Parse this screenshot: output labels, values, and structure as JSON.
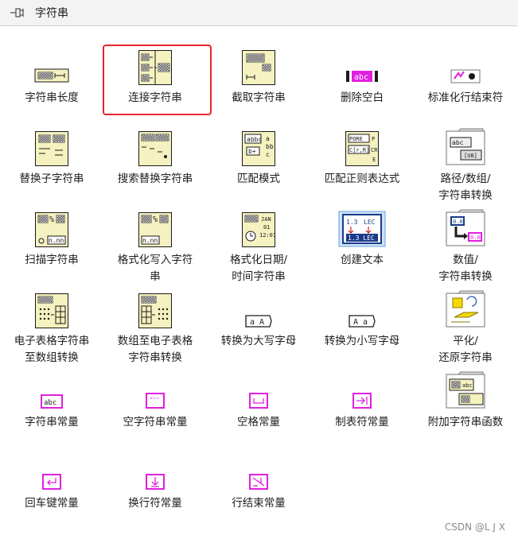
{
  "palette": {
    "title": "字符串",
    "pin_icon": "pin-icon"
  },
  "items": [
    {
      "id": "string-length",
      "lines": [
        "字符串长度"
      ],
      "icon": "string-length-icon"
    },
    {
      "id": "concatenate-strings",
      "lines": [
        "连接字符串"
      ],
      "icon": "concatenate-strings-icon",
      "selected": true
    },
    {
      "id": "string-subset",
      "lines": [
        "截取字符串"
      ],
      "icon": "string-subset-icon"
    },
    {
      "id": "trim-whitespace",
      "lines": [
        "删除空白"
      ],
      "icon": "trim-whitespace-icon"
    },
    {
      "id": "normalize-eol",
      "lines": [
        "标准化行结束符"
      ],
      "icon": "normalize-eol-icon"
    },
    {
      "id": "replace-substring",
      "lines": [
        "替换子字符串"
      ],
      "icon": "replace-substring-icon"
    },
    {
      "id": "search-replace",
      "lines": [
        "搜索替换字符串"
      ],
      "icon": "search-replace-icon"
    },
    {
      "id": "match-pattern",
      "lines": [
        "匹配模式"
      ],
      "icon": "match-pattern-icon"
    },
    {
      "id": "match-regex",
      "lines": [
        "匹配正则表达式"
      ],
      "icon": "match-regex-icon"
    },
    {
      "id": "path-array-string",
      "lines": [
        "路径/数组/",
        "字符串转换"
      ],
      "icon": "folder-icon"
    },
    {
      "id": "scan-from-string",
      "lines": [
        "扫描字符串"
      ],
      "icon": "scan-string-icon"
    },
    {
      "id": "format-into-string",
      "lines": [
        "格式化写入字符",
        "串"
      ],
      "icon": "format-into-string-icon"
    },
    {
      "id": "format-date-time",
      "lines": [
        "格式化日期/",
        "时间字符串"
      ],
      "icon": "format-date-time-icon"
    },
    {
      "id": "build-text",
      "lines": [
        "创建文本"
      ],
      "icon": "build-text-icon"
    },
    {
      "id": "number-string",
      "lines": [
        "数值/",
        "字符串转换"
      ],
      "icon": "number-string-folder-icon"
    },
    {
      "id": "spreadsheet-to-array",
      "lines": [
        "电子表格字符串",
        "至数组转换"
      ],
      "icon": "spreadsheet-to-array-icon"
    },
    {
      "id": "array-to-spreadsheet",
      "lines": [
        "数组至电子表格",
        "字符串转换"
      ],
      "icon": "array-to-spreadsheet-icon"
    },
    {
      "id": "to-upper",
      "lines": [
        "转换为大写字母"
      ],
      "icon": "to-upper-icon"
    },
    {
      "id": "to-lower",
      "lines": [
        "转换为小写字母"
      ],
      "icon": "to-lower-icon"
    },
    {
      "id": "flatten-unflatten",
      "lines": [
        "平化/",
        "还原字符串"
      ],
      "icon": "flatten-folder-icon"
    },
    {
      "id": "string-constant",
      "lines": [
        "字符串常量"
      ],
      "icon": "string-constant-icon"
    },
    {
      "id": "empty-string",
      "lines": [
        "空字符串常量"
      ],
      "icon": "empty-string-icon"
    },
    {
      "id": "space-constant",
      "lines": [
        "空格常量"
      ],
      "icon": "space-constant-icon"
    },
    {
      "id": "tab-constant",
      "lines": [
        "制表符常量"
      ],
      "icon": "tab-constant-icon"
    },
    {
      "id": "additional-string-functions",
      "lines": [
        "附加字符串函数"
      ],
      "icon": "additional-functions-folder-icon"
    },
    {
      "id": "cr-constant",
      "lines": [
        "回车键常量"
      ],
      "icon": "carriage-return-icon"
    },
    {
      "id": "lf-constant",
      "lines": [
        "换行符常量"
      ],
      "icon": "line-feed-icon"
    },
    {
      "id": "eol-constant",
      "lines": [
        "行结束常量"
      ],
      "icon": "end-of-line-icon"
    }
  ],
  "icon_text": {
    "abc": "abc",
    "upper": "a A",
    "lower": "A a",
    "jan": "JAN",
    "d01": "01",
    "t1201": "12:01",
    "lec": "1.3 LEC",
    "num00": "0.0",
    "pore": "PORE",
    "cr": "C[r,R]",
    "nnn": "n.nn",
    "pct": "%",
    "quote": "\"\"\""
  },
  "watermark": "CSDN @L  J X"
}
